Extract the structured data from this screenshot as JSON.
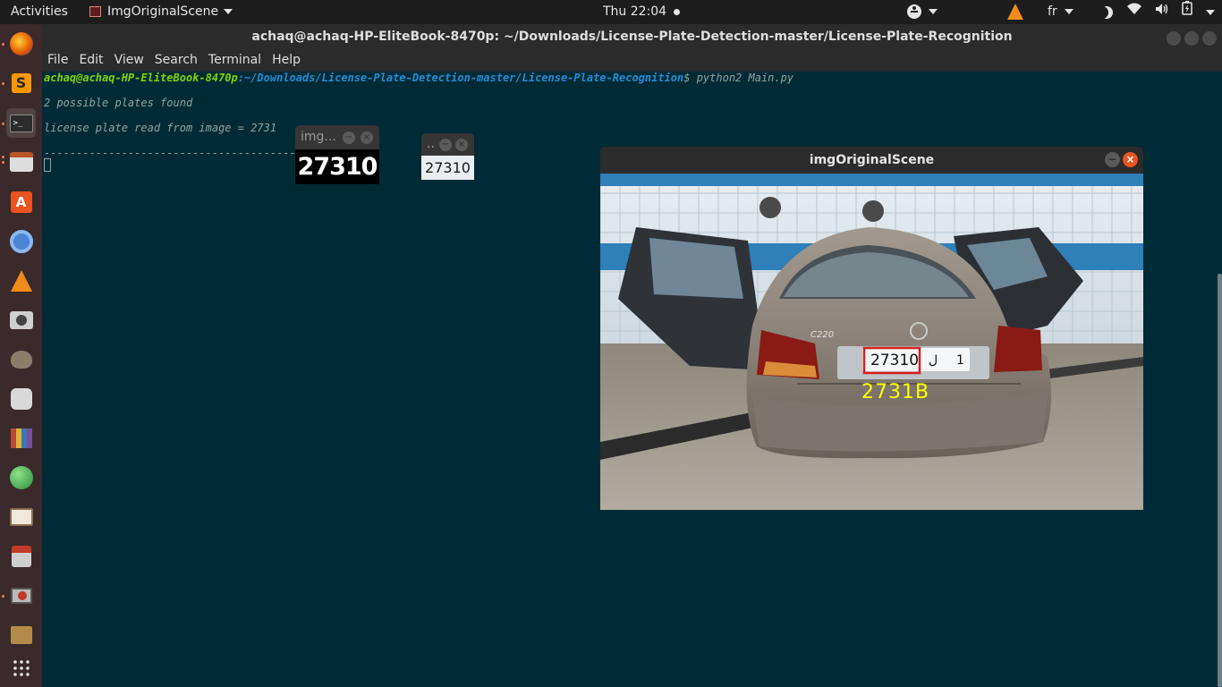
{
  "topbar": {
    "activities": "Activities",
    "app_name": "ImgOriginalScene",
    "clock": "Thu 22:04",
    "keyboard_layout": "fr"
  },
  "dock": {
    "items": [
      "firefox-icon",
      "sublime-icon",
      "terminal-icon",
      "files-icon",
      "software-center-icon",
      "chromium-icon",
      "vlc-icon",
      "camera-icon",
      "gimp-icon",
      "mpv-icon",
      "library-icon",
      "globe-icon",
      "book-icon",
      "usb-creator-icon",
      "disk-app-icon",
      "archive-icon",
      "app-grid-icon"
    ]
  },
  "terminal": {
    "title": "achaq@achaq-HP-EliteBook-8470p: ~/Downloads/License-Plate-Detection-master/License-Plate-Recognition",
    "menu": [
      "File",
      "Edit",
      "View",
      "Search",
      "Terminal",
      "Help"
    ],
    "prompt_user": "achaq@achaq-HP-EliteBook-8470p",
    "prompt_path": ":~/Downloads/License-Plate-Detection-master/License-Plate-Recognition",
    "prompt_cmd": "$ python2 Main.py",
    "line_plates": "2 possible plates found",
    "line_read": "license plate read from image = 2731",
    "line_sep": "-----------------------------------------"
  },
  "small_window_1": {
    "title": "img...",
    "plate_text": "27310"
  },
  "small_window_2": {
    "title": "..",
    "plate_text": "27310"
  },
  "scene_window": {
    "title": "imgOriginalScene",
    "plate_digits": "27310",
    "plate_arabic": "ل",
    "plate_region": "1",
    "detected_text": "2731B",
    "car_badge": "C220"
  },
  "colors": {
    "terminal_bg": "#002b36",
    "prompt_user": "#7fd400",
    "prompt_path": "#268bd2",
    "detected_text": "#ffff00",
    "plate_box": "#d81e1e"
  }
}
